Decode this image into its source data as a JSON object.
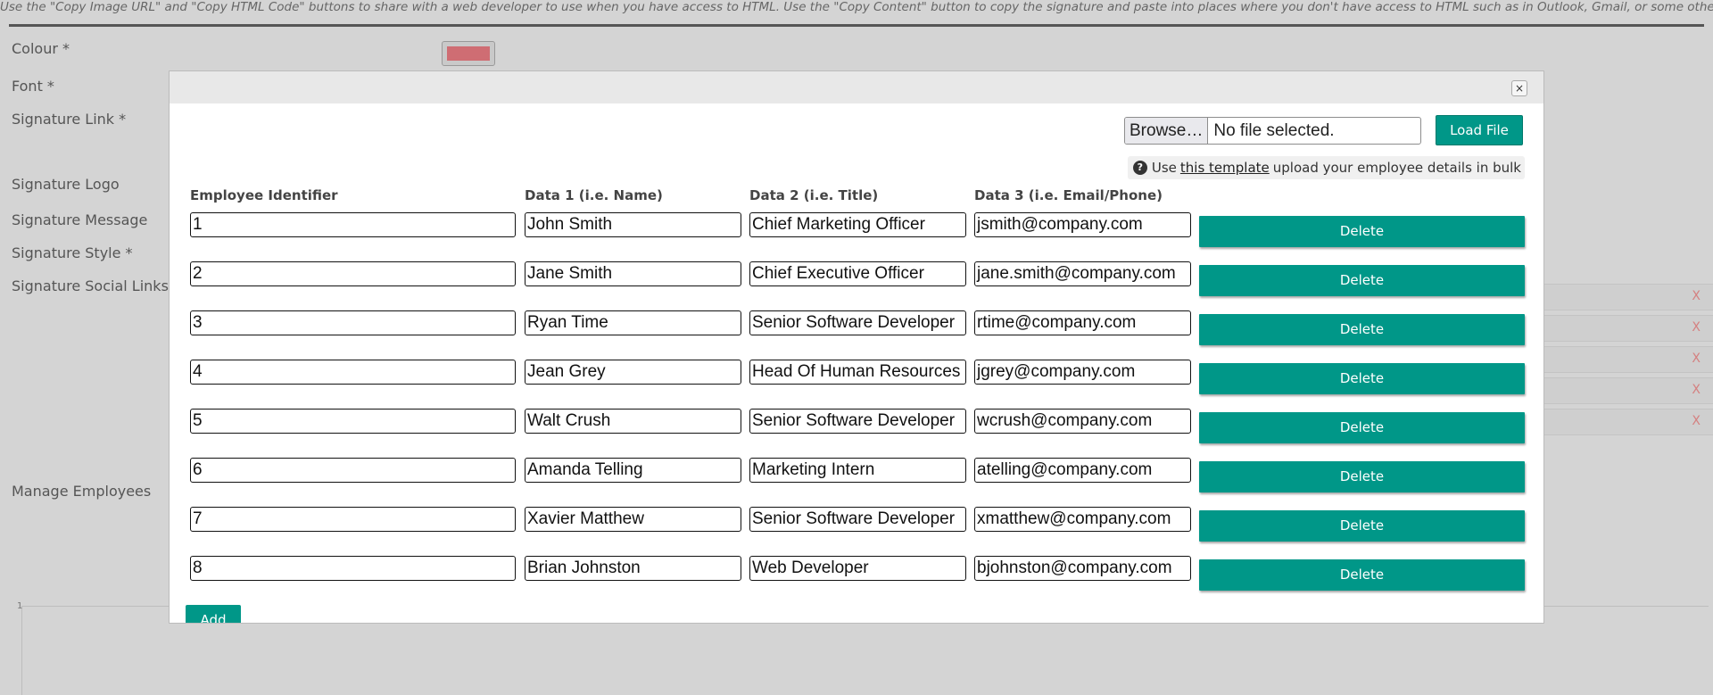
{
  "background": {
    "hint": "Use the \"Copy Image URL\" and \"Copy HTML Code\" buttons to share with a web developer to use when you have access to HTML. Use the \"Copy Content\" button to copy the signature and paste into places where you don't have access to HTML such as in Outlook, Gmail, or some other email application.",
    "labels": {
      "colour": "Colour *",
      "font": "Font *",
      "link": "Signature Link *",
      "logo": "Signature Logo",
      "message": "Signature Message",
      "style": "Signature Style *",
      "social": "Signature Social Links *",
      "manage": "Manage Employees"
    },
    "colour_value": "#cf6d73",
    "social_remove_label": "X",
    "panel_number": "1"
  },
  "modal": {
    "close_label": "×",
    "file": {
      "browse_label": "Browse…",
      "status": "No file selected.",
      "load_label": "Load File"
    },
    "template_note": {
      "prefix": "Use",
      "link": "this template",
      "suffix": "upload your employee details in bulk"
    },
    "columns": {
      "id": "Employee Identifier",
      "d1": "Data 1 (i.e. Name)",
      "d2": "Data 2 (i.e. Title)",
      "d3": "Data 3 (i.e. Email/Phone)"
    },
    "employees": [
      {
        "id": "1",
        "name": "John Smith",
        "title": "Chief Marketing Officer",
        "contact": "jsmith@company.com"
      },
      {
        "id": "2",
        "name": "Jane Smith",
        "title": "Chief Executive Officer",
        "contact": "jane.smith@company.com"
      },
      {
        "id": "3",
        "name": "Ryan Time",
        "title": "Senior Software Developer",
        "contact": "rtime@company.com"
      },
      {
        "id": "4",
        "name": "Jean Grey",
        "title": "Head Of Human Resources",
        "contact": "jgrey@company.com"
      },
      {
        "id": "5",
        "name": "Walt Crush",
        "title": "Senior Software Developer",
        "contact": "wcrush@company.com"
      },
      {
        "id": "6",
        "name": "Amanda Telling",
        "title": "Marketing Intern",
        "contact": "atelling@company.com"
      },
      {
        "id": "7",
        "name": "Xavier Matthew",
        "title": "Senior Software Developer",
        "contact": "xmatthew@company.com"
      },
      {
        "id": "8",
        "name": "Brian Johnston",
        "title": "Web Developer",
        "contact": "bjohnston@company.com"
      }
    ],
    "delete_label": "Delete",
    "add_label": "Add"
  },
  "colors": {
    "accent": "#009788",
    "overlay": "#d4d4d4"
  }
}
